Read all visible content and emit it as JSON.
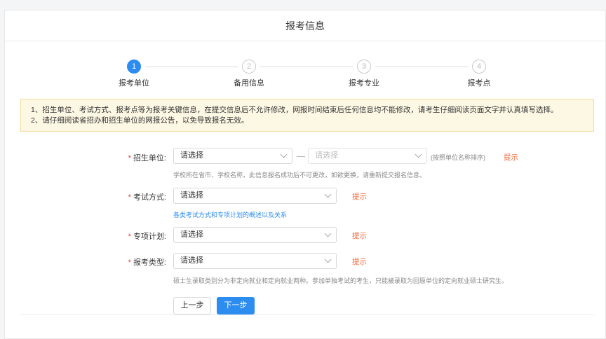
{
  "page": {
    "title": "报考信息"
  },
  "steps": [
    {
      "num": "1",
      "label": "报考单位",
      "active": true
    },
    {
      "num": "2",
      "label": "备用信息",
      "active": false
    },
    {
      "num": "3",
      "label": "报考专业",
      "active": false
    },
    {
      "num": "4",
      "label": "报考点",
      "active": false
    }
  ],
  "notice": {
    "line1": "1、招生单位、考试方式、报考点等为报考关键信息，在提交信息后不允许修改，网报时间结束后任何信息均不能修改，请考生仔细阅读页面文字并认真填写选择。",
    "line2": "2、请仔细阅读省招办和招生单位的网报公告，以免导致报名无效。"
  },
  "form": {
    "required_mark": "*",
    "unit": {
      "label": "招生单位:",
      "select1": "请选择",
      "select2": "请选择",
      "note": "(按照单位名称排序)",
      "hint": "提示",
      "help": "学校所在省市、学校名称，此信息报名成功后不可更改，如欲更换，请重新提交报名信息。"
    },
    "exam_method": {
      "label": "考试方式:",
      "select": "请选择",
      "hint": "提示",
      "link": "各类考试方式和专项计划的概述以及关系"
    },
    "special_plan": {
      "label": "专项计划:",
      "select": "请选择",
      "hint": "提示"
    },
    "apply_type": {
      "label": "报考类型:",
      "select": "请选择",
      "hint": "提示",
      "help": "硕士生录取类别分为非定向就业和定向就业两种。参加单独考试的考生，只能被录取为回原单位的定向就业硕士研究生。"
    }
  },
  "buttons": {
    "prev": "上一步",
    "next": "下一步"
  },
  "colors": {
    "primary": "#2d8cf0",
    "hint": "#ef6b3f",
    "required": "#e04040",
    "notice_bg": "#fdf8e4",
    "notice_border": "#f2dca0"
  }
}
